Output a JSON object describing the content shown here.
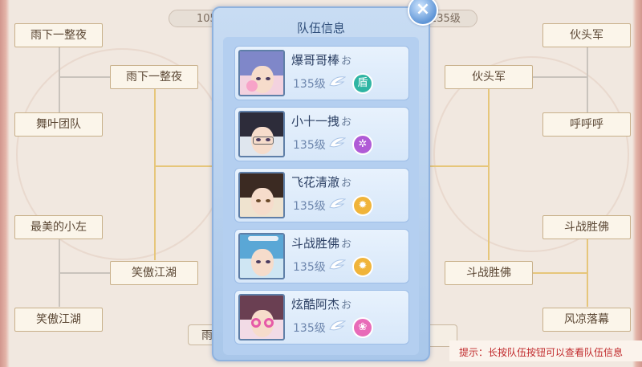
{
  "bracket": {
    "top_left_pill": "105",
    "top_right_pill": "135级",
    "bottom_left_pill": "雨",
    "left": {
      "round1": [
        "雨下一整夜",
        "舞叶团队",
        "最美的小左",
        "笑傲江湖"
      ],
      "round2": [
        "雨下一整夜",
        "笑傲江湖"
      ]
    },
    "right": {
      "round1": [
        "伙头军",
        "呼呼呼",
        "斗战胜佛",
        "风凉落幕"
      ],
      "round2": [
        "伙头军",
        "斗战胜佛"
      ]
    }
  },
  "popup": {
    "title": "队伍信息",
    "close_label": "×",
    "members": [
      {
        "name": "爆哥哥棒",
        "symbol": "お",
        "level": "135级",
        "school_icon": "shield-icon",
        "school_glyph": "盾",
        "school_color": "#2fb5a3"
      },
      {
        "name": "小十一拽",
        "symbol": "お",
        "level": "135级",
        "school_icon": "spider-icon",
        "school_glyph": "✲",
        "school_color": "#b05bd6"
      },
      {
        "name": "飞花清澈",
        "symbol": "お",
        "level": "135级",
        "school_icon": "sun-icon",
        "school_glyph": "✹",
        "school_color": "#f0b43a"
      },
      {
        "name": "斗战胜佛",
        "symbol": "お",
        "level": "135级",
        "school_icon": "sun-icon",
        "school_glyph": "✹",
        "school_color": "#f0b43a"
      },
      {
        "name": "炫酷阿杰",
        "symbol": "お",
        "level": "135级",
        "school_icon": "lotus-icon",
        "school_glyph": "❀",
        "school_color": "#e86bb8"
      }
    ]
  },
  "hint": "提示：长按队伍按钮可以查看队伍信息",
  "colors": {
    "accent": "#5f95d6",
    "hint": "#c0282a",
    "line_gold": "#e6c67a"
  }
}
